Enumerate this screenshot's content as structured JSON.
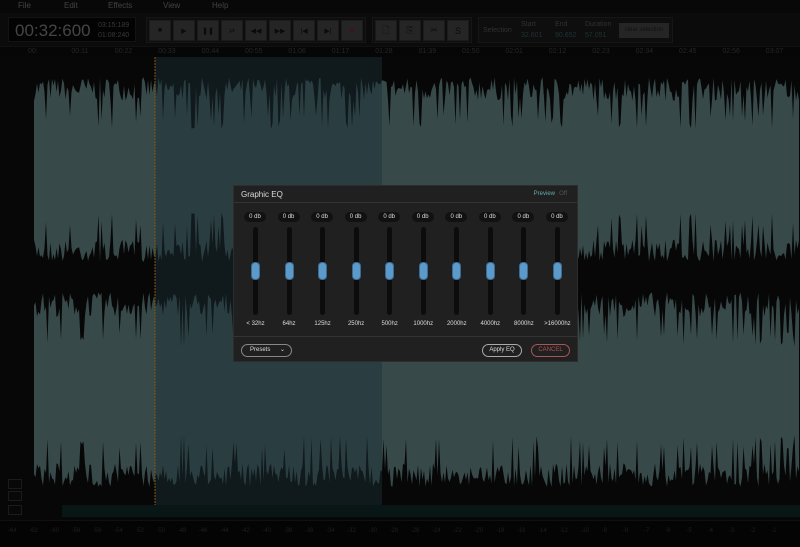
{
  "menu": [
    "File",
    "Edit",
    "Effects",
    "View",
    "Help"
  ],
  "time": {
    "current": "00:32:600",
    "total": "03:15:189",
    "secondary": "01:08:240"
  },
  "transport": [
    "stop",
    "play",
    "pause",
    "loop",
    "rewind",
    "fast-forward",
    "skip-start",
    "skip-end",
    "record"
  ],
  "tools": [
    "new-file",
    "paste",
    "cut",
    "silence"
  ],
  "silence_label": "S",
  "selection": {
    "label": "Selection",
    "start_label": "Start",
    "start": "32.601",
    "end_label": "End",
    "end": "90.652",
    "duration_label": "Duration",
    "duration": "57.051",
    "clear_label": "clear selection"
  },
  "ruler": [
    "00:",
    "00:11",
    "00:22",
    "00:33",
    "00:44",
    "00:55",
    "01:06",
    "01:17",
    "01:28",
    "01:39",
    "01:50",
    "02:01",
    "02:12",
    "02:23",
    "02:34",
    "02:45",
    "02:56",
    "03:07"
  ],
  "meter": [
    "-64",
    "-62",
    "-60",
    "-58",
    "-56",
    "-54",
    "-52",
    "-50",
    "-48",
    "-46",
    "-44",
    "-42",
    "-40",
    "-38",
    "-36",
    "-34",
    "-32",
    "-30",
    "-28",
    "-26",
    "-24",
    "-22",
    "-20",
    "-18",
    "-16",
    "-14",
    "-12",
    "-10",
    "-9",
    "-8",
    "-7",
    "-6",
    "-5",
    "-4",
    "-3",
    "-2",
    "-1"
  ],
  "eq": {
    "title": "Graphic EQ",
    "preview": "Preview",
    "preview_state": "Off",
    "bands": [
      {
        "freq": "< 32hz",
        "gain": "0 db",
        "level": 0.5
      },
      {
        "freq": "64hz",
        "gain": "0 db",
        "level": 0.5
      },
      {
        "freq": "125hz",
        "gain": "0 db",
        "level": 0.5
      },
      {
        "freq": "250hz",
        "gain": "0 db",
        "level": 0.5
      },
      {
        "freq": "500hz",
        "gain": "0 db",
        "level": 0.5
      },
      {
        "freq": "1000hz",
        "gain": "0 db",
        "level": 0.5
      },
      {
        "freq": "2000hz",
        "gain": "0 db",
        "level": 0.5
      },
      {
        "freq": "4000hz",
        "gain": "0 db",
        "level": 0.5
      },
      {
        "freq": "8000hz",
        "gain": "0 db",
        "level": 0.5
      },
      {
        "freq": ">16000hz",
        "gain": "0 db",
        "level": 0.5
      }
    ],
    "presets": "Presets",
    "apply": "Apply EQ",
    "cancel": "CANCEL"
  },
  "colors": {
    "wave": "#6f9494",
    "selection": "#2a4a55",
    "cursor": "#d08020",
    "thumb": "#5c9ac9"
  }
}
